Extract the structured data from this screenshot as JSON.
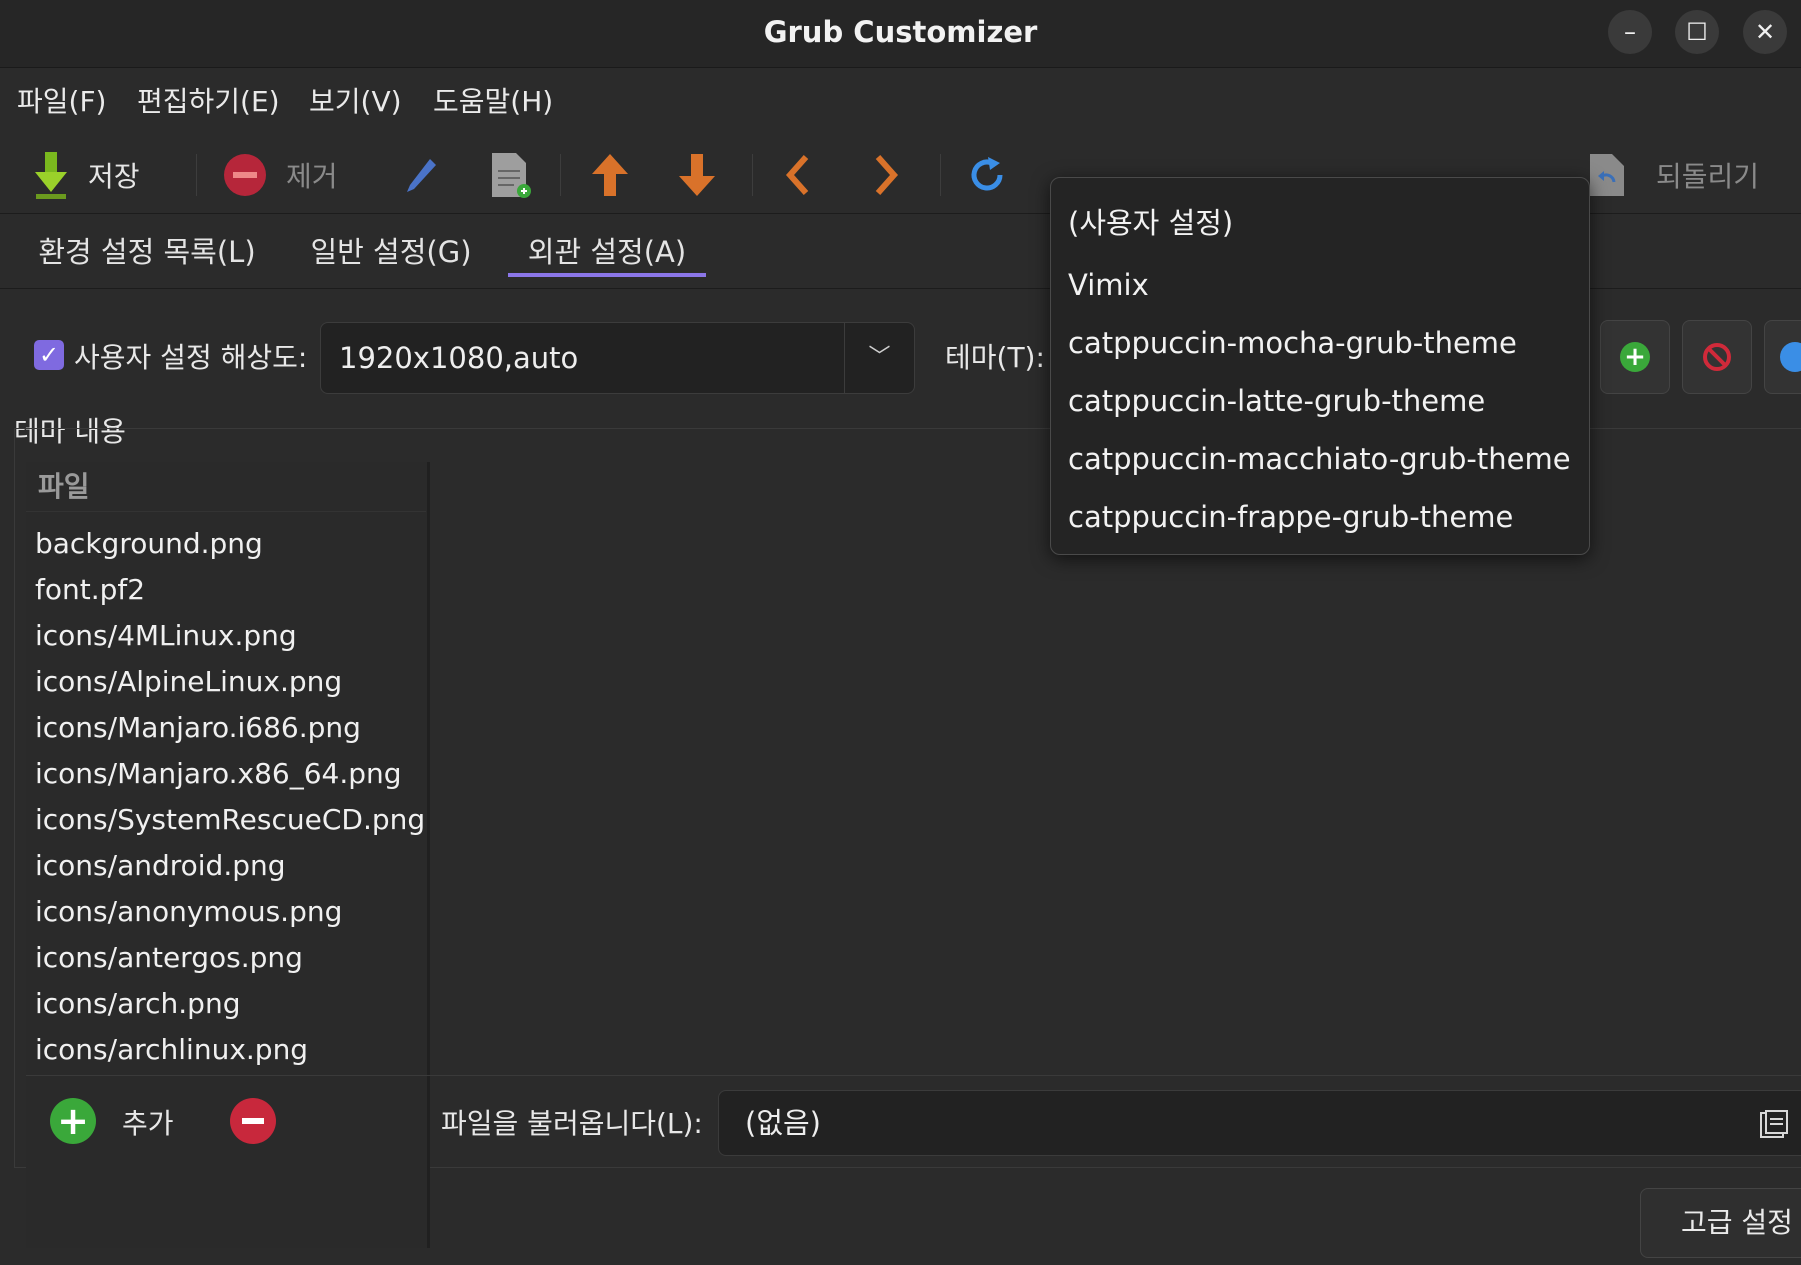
{
  "window": {
    "title": "Grub Customizer"
  },
  "menubar": {
    "items": [
      "파일(F)",
      "편집하기(E)",
      "보기(V)",
      "도움말(H)"
    ]
  },
  "toolbar": {
    "save": "저장",
    "remove": "제거",
    "revert": "되돌리기"
  },
  "tabs": {
    "items": [
      "환경 설정 목록(L)",
      "일반 설정(G)",
      "외관 설정(A)"
    ],
    "active_index": 2
  },
  "appearance": {
    "custom_resolution_label": "사용자 설정 해상도:",
    "custom_resolution_checked": true,
    "resolution_value": "1920x1080,auto",
    "theme_label": "테마(T):",
    "theme_contents_label": "테마 내용"
  },
  "theme_dropdown": {
    "options": [
      "(사용자 설정)",
      "Vimix",
      "catppuccin-mocha-grub-theme",
      "catppuccin-latte-grub-theme",
      "catppuccin-macchiato-grub-theme",
      "catppuccin-frappe-grub-theme"
    ]
  },
  "file_list": {
    "header": "파일",
    "items": [
      "background.png",
      "font.pf2",
      "icons/4MLinux.png",
      "icons/AlpineLinux.png",
      "icons/Manjaro.i686.png",
      "icons/Manjaro.x86_64.png",
      "icons/SystemRescueCD.png",
      "icons/android.png",
      "icons/anonymous.png",
      "icons/antergos.png",
      "icons/arch.png",
      "icons/archlinux.png"
    ]
  },
  "bottom": {
    "add_label": "추가",
    "load_file_label": "파일을 불러옵니다(L):",
    "load_file_value": "(없음)",
    "advanced_button": "고급 설정"
  },
  "colors": {
    "accent": "#8b76e8",
    "add_green": "#3aa83a",
    "remove_red": "#c8283c",
    "arrow_orange": "#d9722a",
    "refresh_blue": "#3a8ee6"
  }
}
